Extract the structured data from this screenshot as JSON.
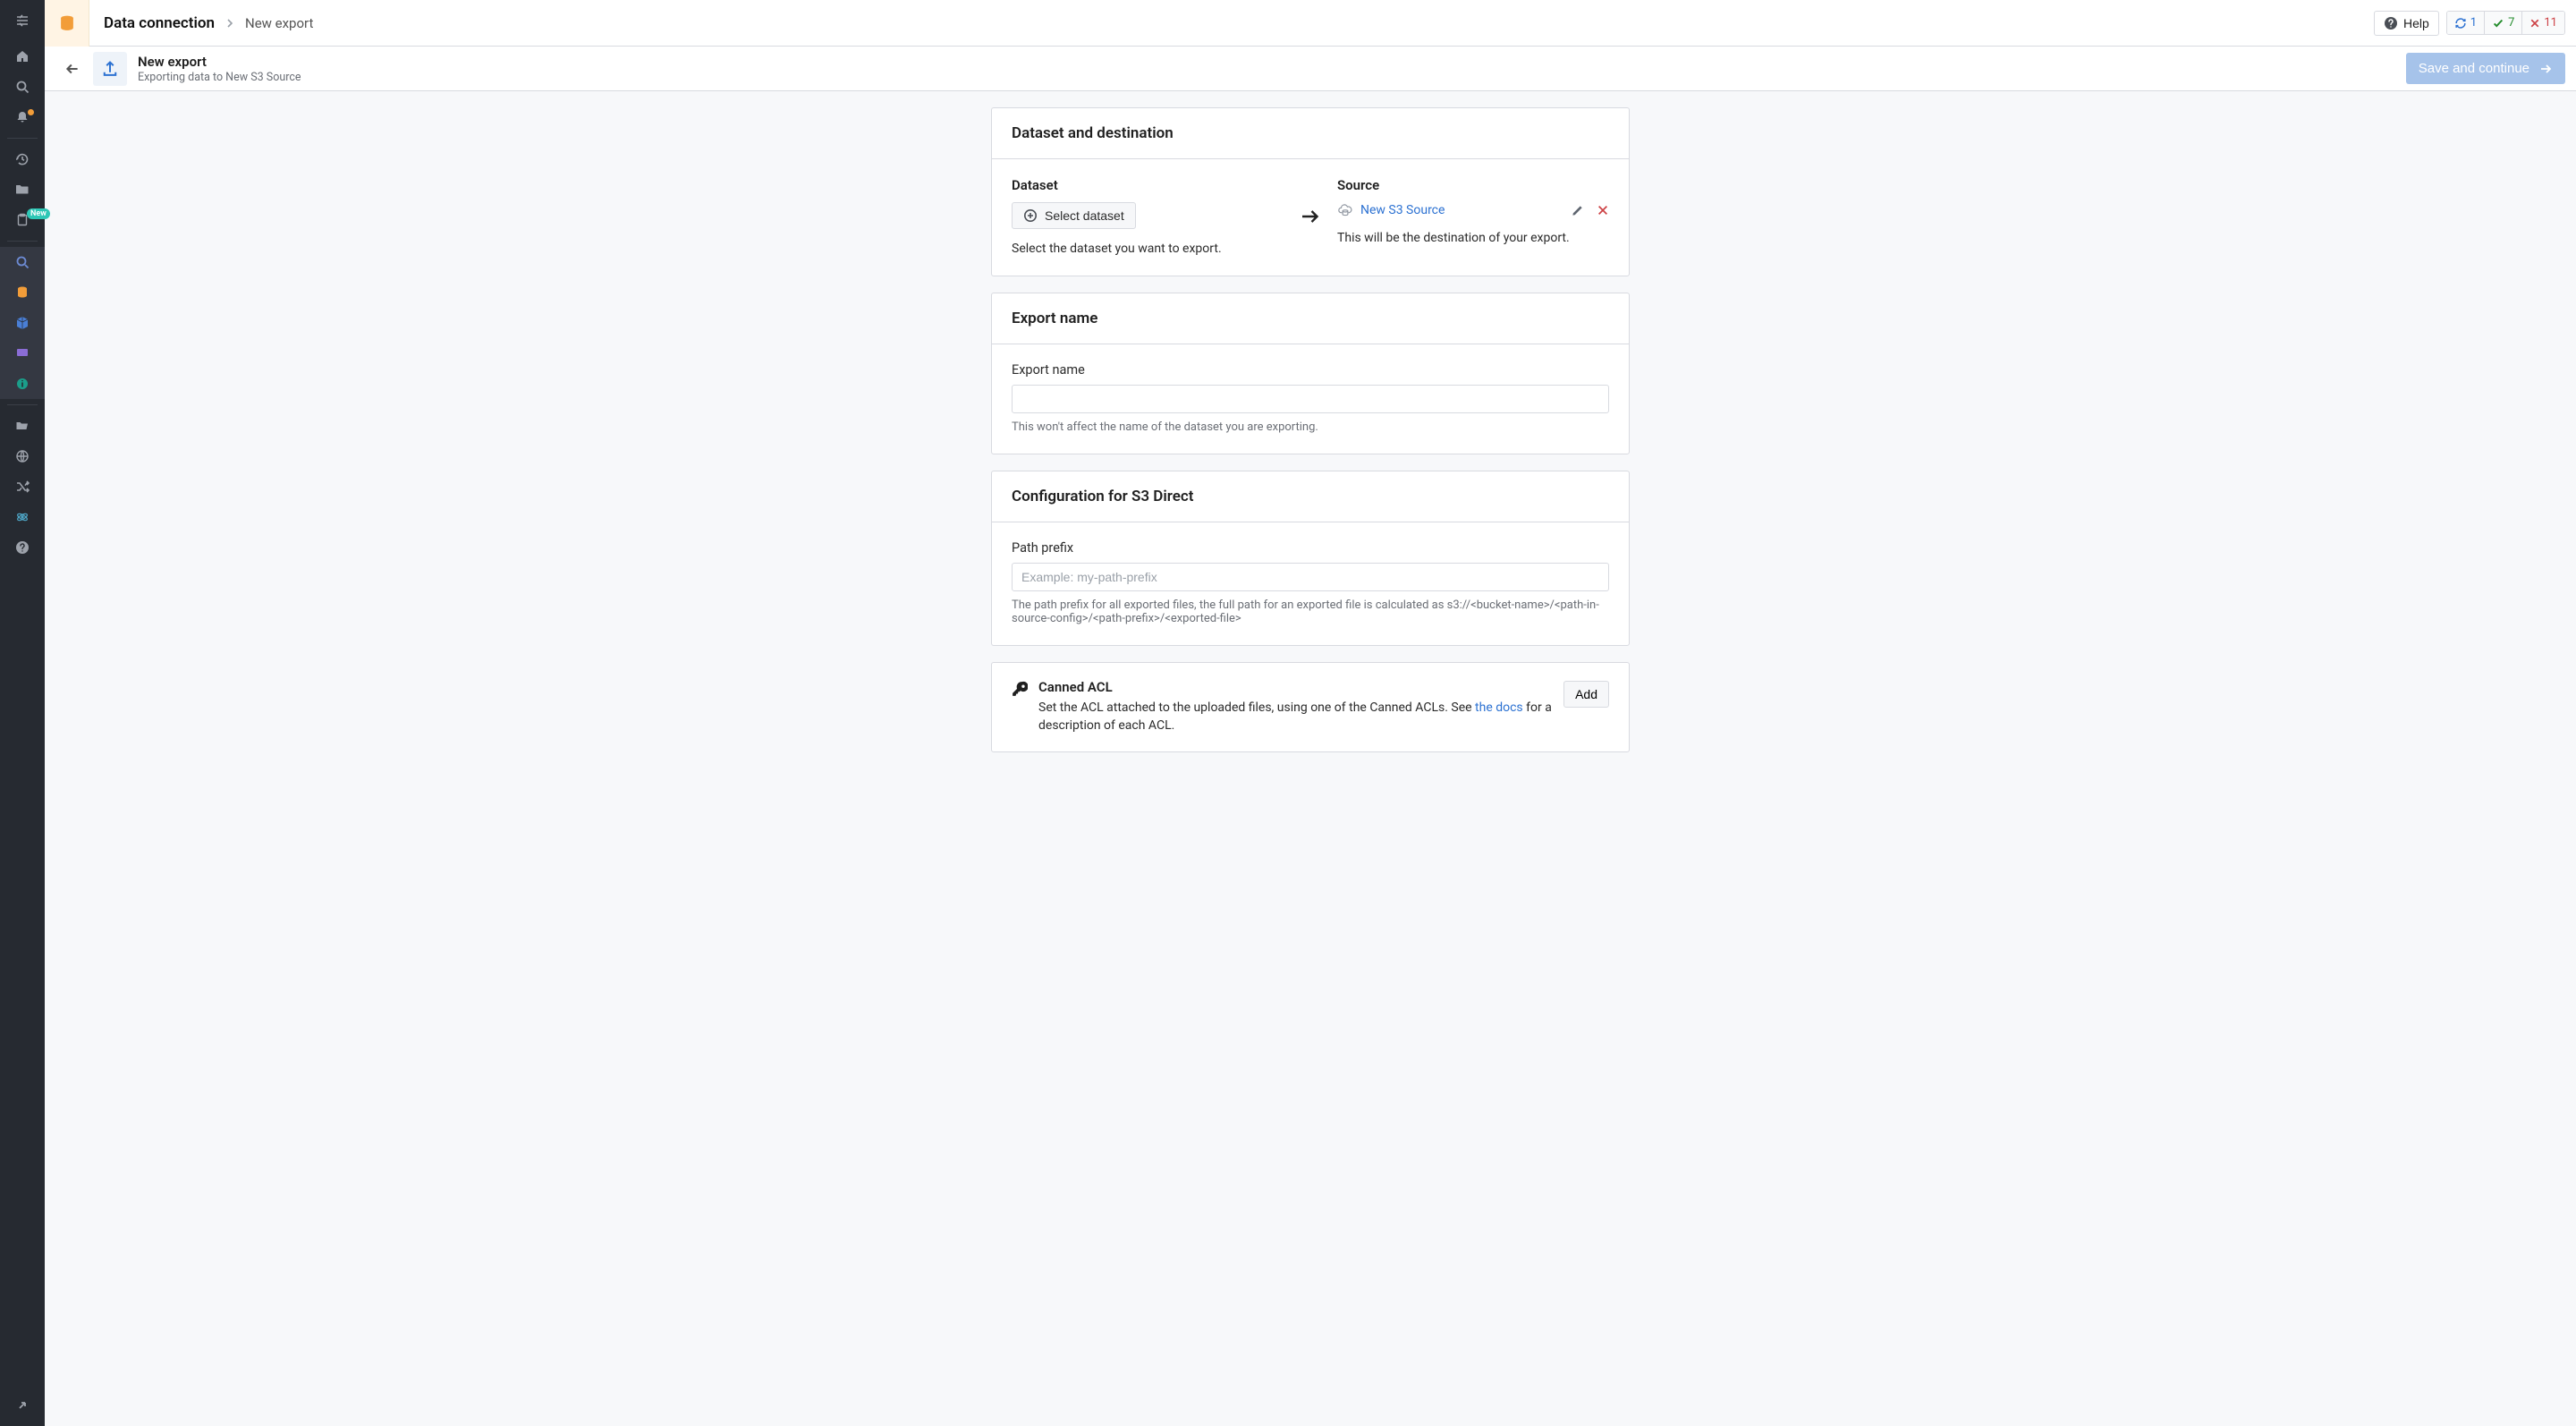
{
  "breadcrumb": {
    "root": "Data connection",
    "current": "New export"
  },
  "topbar": {
    "help_label": "Help",
    "status": {
      "syncing": "1",
      "ok": "7",
      "errors": "11"
    }
  },
  "subheader": {
    "title": "New export",
    "subtitle": "Exporting data to New S3 Source",
    "save_label": "Save and continue"
  },
  "dd_card": {
    "title": "Dataset and destination",
    "dataset": {
      "label": "Dataset",
      "button": "Select dataset",
      "helper": "Select the dataset you want to export."
    },
    "source": {
      "label": "Source",
      "link": "New S3 Source",
      "helper": "This will be the destination of your export."
    }
  },
  "name_card": {
    "title": "Export name",
    "field_label": "Export name",
    "value": "",
    "hint": "This won't affect the name of the dataset you are exporting."
  },
  "config_card": {
    "title": "Configuration for S3 Direct",
    "field_label": "Path prefix",
    "placeholder": "Example: my-path-prefix",
    "value": "",
    "hint": "The path prefix for all exported files, the full path for an exported file is calculated as s3://<bucket-name>/<path-in-source-config>/<path-prefix>/<exported-file>"
  },
  "acl_card": {
    "title": "Canned ACL",
    "desc_pre": "Set the ACL attached to the uploaded files, using one of the Canned ACLs. See ",
    "desc_link": "the docs",
    "desc_post": " for a description of each ACL.",
    "add_label": "Add"
  },
  "sidebar_new_badge": "New"
}
